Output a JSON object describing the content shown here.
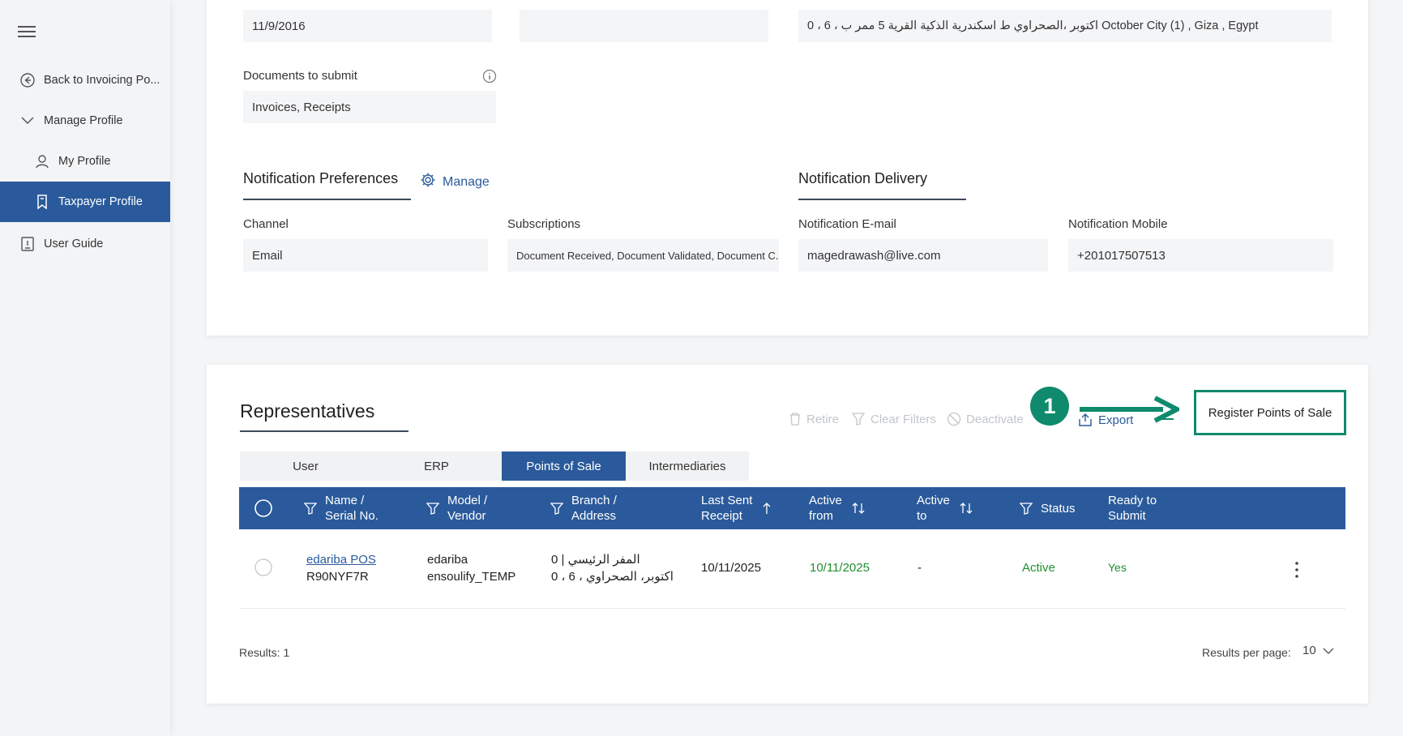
{
  "sidebar": {
    "items": [
      {
        "label": "Back to Invoicing Po...",
        "icon": "back-circle-icon"
      },
      {
        "label": "Manage Profile",
        "icon": "chevron-down-icon"
      },
      {
        "label": "My Profile",
        "icon": "user-icon"
      },
      {
        "label": "Taxpayer Profile",
        "icon": "bookmark-icon",
        "active": true
      },
      {
        "label": "User Guide",
        "icon": "book-icon"
      }
    ]
  },
  "profile": {
    "date_value": "11/9/2016",
    "empty_value": "",
    "address_value": "0 ، 6 ، اكتوبر ،الصحراوي ط اسكندرية الذكية القرية 5 ممر ب October City (1) , Giza , Egypt",
    "documents_label": "Documents to submit",
    "documents_value": "Invoices, Receipts"
  },
  "notifications": {
    "preferences_title": "Notification Preferences",
    "manage_label": "Manage",
    "delivery_title": "Notification Delivery",
    "channel_label": "Channel",
    "channel_value": "Email",
    "subscriptions_label": "Subscriptions",
    "subscriptions_value": "Document Received, Document Validated, Document C...",
    "email_label": "Notification E-mail",
    "email_value": "magedrawash@live.com",
    "mobile_label": "Notification Mobile",
    "mobile_value": "+201017507513"
  },
  "representatives": {
    "title": "Representatives",
    "toolbar": {
      "retire": "Retire",
      "clear_filters": "Clear Filters",
      "deactivate": "Deactivate",
      "export": "Export",
      "register": "Register Points of Sale"
    },
    "badge": "1",
    "tabs": [
      "User",
      "ERP",
      "Points of Sale",
      "Intermediaries"
    ],
    "active_tab": "Points of Sale",
    "columns": {
      "name_1": "Name /",
      "name_2": "Serial No.",
      "model_1": "Model /",
      "model_2": "Vendor",
      "branch_1": "Branch /",
      "branch_2": "Address",
      "last_1": "Last Sent",
      "last_2": "Receipt",
      "from_1": "Active",
      "from_2": "from",
      "to_1": "Active",
      "to_2": "to",
      "status": "Status",
      "ready_1": "Ready to",
      "ready_2": "Submit"
    },
    "row": {
      "name": "edariba POS",
      "serial": "R90NYF7R",
      "model": "edariba",
      "vendor": "ensoulify_TEMP",
      "branch_line1": "0 | المفر الرئيسي",
      "branch_line2": "0 ، 6 ، اكتوبر، الصحراوي",
      "last_sent": "10/11/2025",
      "active_from": "10/11/2025",
      "active_to": "-",
      "status": "Active",
      "ready": "Yes"
    },
    "results_label": "Results: 1",
    "per_page_label": "Results per page:",
    "per_page_value": "10"
  },
  "colors": {
    "primary": "#2a5a9b",
    "accent_green": "#0f8a6d",
    "status_green": "#1f8f2e"
  }
}
